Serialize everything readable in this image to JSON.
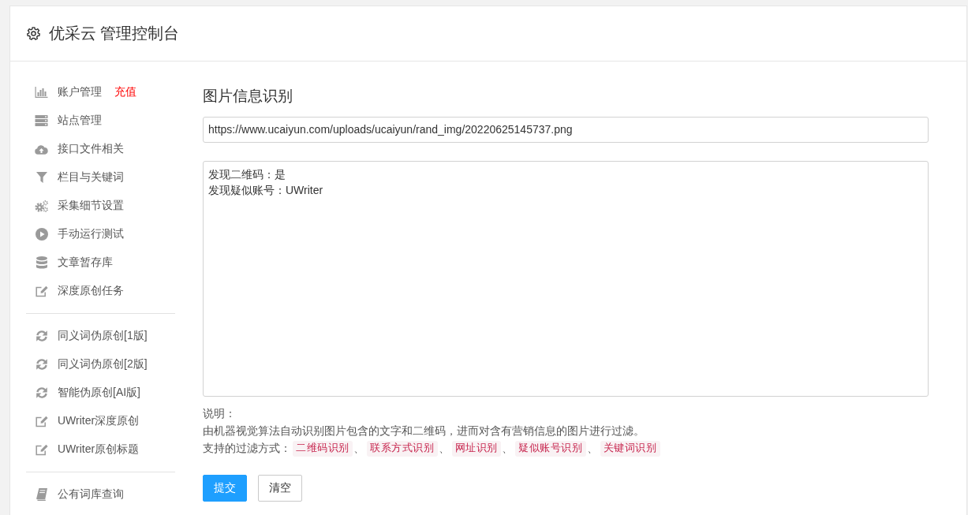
{
  "header": {
    "title": "优采云 管理控制台"
  },
  "sidebar": {
    "groups": [
      {
        "items": [
          {
            "label": "账户管理",
            "badge": "充值"
          },
          {
            "label": "站点管理"
          },
          {
            "label": "接口文件相关"
          },
          {
            "label": "栏目与关键词"
          },
          {
            "label": "采集细节设置"
          },
          {
            "label": "手动运行测试"
          },
          {
            "label": "文章暂存库"
          },
          {
            "label": "深度原创任务"
          }
        ]
      },
      {
        "items": [
          {
            "label": "同义词伪原创[1版]"
          },
          {
            "label": "同义词伪原创[2版]"
          },
          {
            "label": "智能伪原创[AI版]"
          },
          {
            "label": "UWriter深度原创"
          },
          {
            "label": "UWriter原创标题"
          }
        ]
      },
      {
        "items": [
          {
            "label": "公有词库查询"
          }
        ]
      }
    ]
  },
  "main": {
    "title": "图片信息识别",
    "url_field": {
      "value": "https://www.ucaiyun.com/uploads/ucaiyun/rand_img/20220625145737.png"
    },
    "result_field": {
      "lines": [
        "发现二维码：是",
        "发现疑似账号：UWriter"
      ]
    },
    "notes": {
      "heading": "说明：",
      "description": "由机器视觉算法自动识别图片包含的文字和二维码，进而对含有营销信息的图片进行过滤。",
      "filters_label": "支持的过滤方式：",
      "filters": [
        {
          "label": "二维码识别",
          "separator": "、"
        },
        {
          "label": "联系方式识别",
          "separator": "、"
        },
        {
          "label": "网址识别",
          "separator": "、"
        },
        {
          "label": "疑似账号识别",
          "separator": "、"
        },
        {
          "label": "关键词识别"
        }
      ]
    },
    "buttons": [
      {
        "label": "提交",
        "kind": "primary"
      },
      {
        "label": "清空",
        "kind": "default"
      }
    ]
  }
}
